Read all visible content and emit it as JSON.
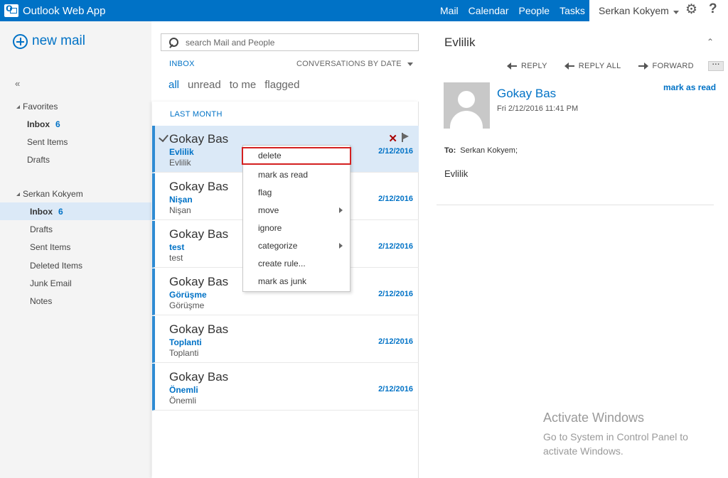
{
  "app": {
    "title": "Outlook Web App"
  },
  "nav": {
    "links": [
      "Mail",
      "Calendar",
      "People",
      "Tasks"
    ]
  },
  "user": {
    "name": "Serkan Kokyem"
  },
  "leftnav": {
    "new_mail": "new mail",
    "collapse": "«",
    "favorites": {
      "title": "Favorites",
      "items": [
        {
          "label": "Inbox",
          "count": "6"
        },
        {
          "label": "Sent Items"
        },
        {
          "label": "Drafts"
        }
      ]
    },
    "account": {
      "title": "Serkan Kokyem",
      "items": [
        {
          "label": "Inbox",
          "count": "6"
        },
        {
          "label": "Drafts"
        },
        {
          "label": "Sent Items"
        },
        {
          "label": "Deleted Items"
        },
        {
          "label": "Junk Email"
        },
        {
          "label": "Notes"
        }
      ]
    }
  },
  "search": {
    "placeholder": "search Mail and People"
  },
  "list": {
    "folder": "INBOX",
    "sort": "CONVERSATIONS BY DATE",
    "filters": [
      "all",
      "unread",
      "to me",
      "flagged"
    ],
    "group": "LAST MONTH",
    "messages": [
      {
        "from": "Gokay Bas",
        "subject": "Evlilik",
        "preview": "Evlilik",
        "date": "2/12/2016"
      },
      {
        "from": "Gokay Bas",
        "subject": "Nişan",
        "preview": "Nişan",
        "date": "2/12/2016"
      },
      {
        "from": "Gokay Bas",
        "subject": "test",
        "preview": "test",
        "date": "2/12/2016"
      },
      {
        "from": "Gokay Bas",
        "subject": "Görüşme",
        "preview": "Görüşme",
        "date": "2/12/2016"
      },
      {
        "from": "Gokay Bas",
        "subject": "Toplanti",
        "preview": "Toplanti",
        "date": "2/12/2016"
      },
      {
        "from": "Gokay Bas",
        "subject": "Önemli",
        "preview": "Önemli",
        "date": "2/12/2016"
      }
    ]
  },
  "context_menu": {
    "items": [
      "delete",
      "mark as read",
      "flag",
      "move",
      "ignore",
      "categorize",
      "create rule...",
      "mark as junk"
    ]
  },
  "reading": {
    "subject": "Evlilik",
    "actions": {
      "reply": "REPLY",
      "reply_all": "REPLY ALL",
      "forward": "FORWARD"
    },
    "sender": "Gokay Bas",
    "date": "Fri 2/12/2016 11:41 PM",
    "mark_read": "mark as read",
    "to_label": "To:",
    "to_value": "Serkan Kokyem;",
    "body": "Evlilik"
  },
  "overlay": {
    "title": "Activate Windows",
    "text": "Go to System in Control Panel to activate Windows."
  },
  "colors": {
    "accent": "#0072c6",
    "selected": "#dbe9f7",
    "highlight_border": "#d42020"
  }
}
